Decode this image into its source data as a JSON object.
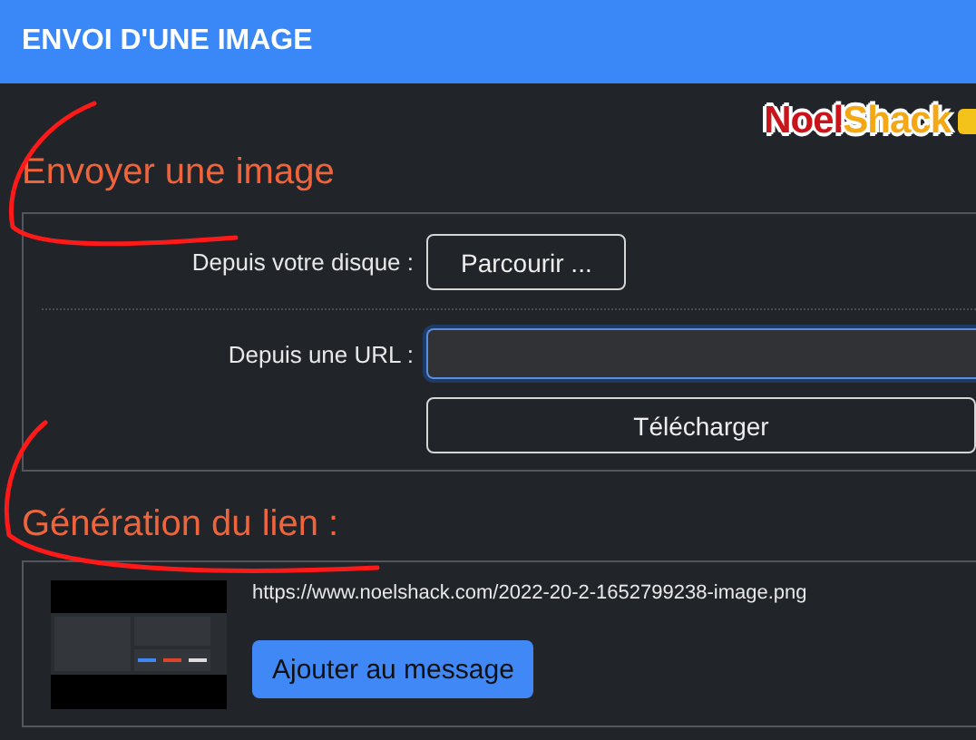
{
  "header": {
    "title": "ENVOI D'UNE IMAGE"
  },
  "logo": {
    "part_1": "Noel",
    "part_2": "Shack"
  },
  "upload": {
    "heading": "Envoyer une image",
    "disk_label": "Depuis votre disque :",
    "browse_button": "Parcourir ...",
    "url_label": "Depuis une URL :",
    "url_focused": true,
    "download_button": "Télécharger"
  },
  "link": {
    "heading": "Génération du lien :",
    "url": "https://www.noelshack.com/2022-20-2-1652799238-image.png",
    "add_button": "Ajouter au message"
  }
}
